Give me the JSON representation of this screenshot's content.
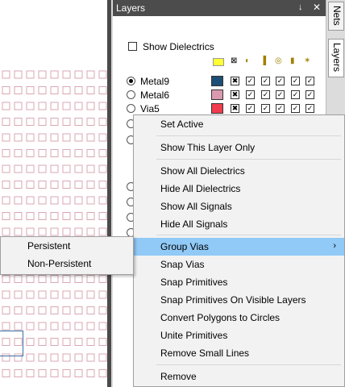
{
  "panel": {
    "title": "Layers",
    "pin_icon": "pin-icon",
    "close_icon": "close-icon",
    "show_dielectrics_label": "Show Dielectrics",
    "show_dielectrics_checked": false,
    "column_icons": [
      "color-icon",
      "visibility-icon",
      "signal-icon",
      "trace-icon",
      "via-icon",
      "primitive-icon",
      "other-icon"
    ],
    "layers": [
      {
        "name": "Metal9",
        "active": true,
        "color": "#1d4e75"
      },
      {
        "name": "Metal6",
        "active": false,
        "color": "#d99ab0"
      },
      {
        "name": "Via5",
        "active": false,
        "color": "#f03c4e"
      }
    ]
  },
  "side_tabs": [
    "Nets",
    "Layers"
  ],
  "context_menu": {
    "items": [
      {
        "label": "Set Active"
      },
      {
        "label": "Show This Layer Only"
      },
      {
        "label": "Show All Dielectrics"
      },
      {
        "label": "Hide All Dielectrics"
      },
      {
        "label": "Show All Signals"
      },
      {
        "label": "Hide All Signals"
      },
      {
        "label": "Group Vias",
        "submenu": true,
        "highlighted": true
      },
      {
        "label": "Snap Vias"
      },
      {
        "label": "Snap Primitives"
      },
      {
        "label": "Snap Primitives On Visible Layers"
      },
      {
        "label": "Convert Polygons to Circles"
      },
      {
        "label": "Unite Primitives"
      },
      {
        "label": "Remove Small Lines"
      },
      {
        "label": "Remove"
      }
    ],
    "submenu_arrow": "›"
  },
  "submenu": {
    "items": [
      "Persistent",
      "Non-Persistent"
    ]
  },
  "colors": {
    "highlight": "#91c9f7",
    "via_pad": "#d9a7b3",
    "title_bar": "#4c4c4c"
  }
}
